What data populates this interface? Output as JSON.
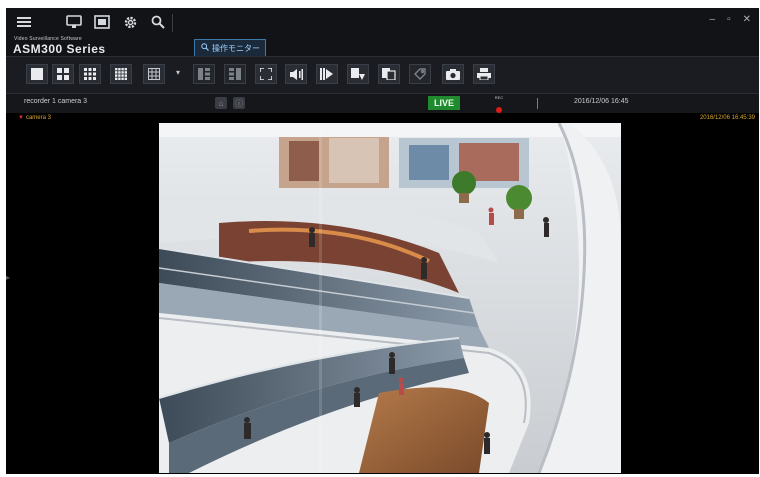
{
  "brand": {
    "subtitle": "Video Surveillance Software",
    "name": "ASM300 Series"
  },
  "tab": {
    "label": "操作モニター"
  },
  "status": {
    "camera_label": "recorder 1 camera 3",
    "live_label": "LIVE",
    "rec_label": "REC",
    "datetime": "2016/12/06 16:45"
  },
  "viewer": {
    "camera_name": "camera 3",
    "timestamp": "2016/12/06 16:45:39"
  },
  "colors": {
    "live_bg": "#1f8a2e",
    "rec_dot": "#e01b1b",
    "overlay_text": "#d9a72a",
    "tab_border": "#3c79a8"
  },
  "icons": {
    "topbar": [
      "menu-icon",
      "monitor-icon",
      "camera-view-icon",
      "gear-icon",
      "search-icon"
    ],
    "toolbar": [
      "layout-1-icon",
      "layout-4-icon",
      "layout-9-icon",
      "layout-16-icon",
      "layout-custom-icon",
      "layout-dropdown-icon",
      "sequence-prev-icon",
      "sequence-next-icon",
      "fullscreen-icon",
      "audio-icon",
      "playback-icon",
      "export-icon",
      "copy-icon",
      "tag-icon",
      "snapshot-icon",
      "print-icon"
    ]
  }
}
